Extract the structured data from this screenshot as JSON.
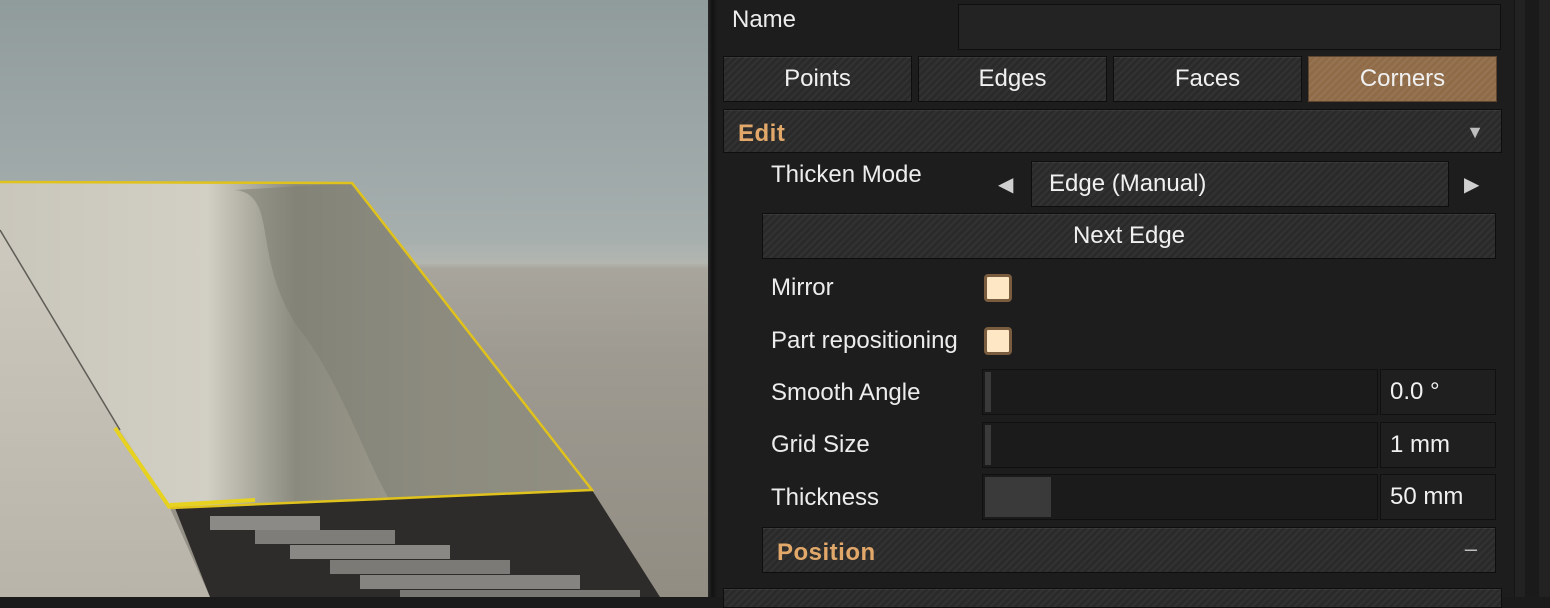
{
  "name_label": "Name",
  "name_value": "",
  "tabs": [
    {
      "label": "Points",
      "active": false
    },
    {
      "label": "Edges",
      "active": false
    },
    {
      "label": "Faces",
      "active": false
    },
    {
      "label": "Corners",
      "active": true
    }
  ],
  "edit_section": {
    "title": "Edit",
    "toggle_icon": "triangle-down-icon"
  },
  "thicken_mode": {
    "label": "Thicken Mode",
    "value": "Edge (Manual)",
    "prev_icon": "triangle-left-icon",
    "next_icon": "triangle-right-icon"
  },
  "next_edge_label": "Next Edge",
  "mirror": {
    "label": "Mirror",
    "checked": false
  },
  "part_repositioning": {
    "label": "Part repositioning",
    "checked": false
  },
  "smooth_angle": {
    "label": "Smooth Angle",
    "value": "0.0 °",
    "level": 0.0
  },
  "grid_size": {
    "label": "Grid Size",
    "value": "1 mm",
    "level": 0.0
  },
  "thickness": {
    "label": "Thickness",
    "value": "50 mm",
    "level": 0.17
  },
  "position_section": {
    "title": "Position",
    "toggle_icon": "minus-icon"
  },
  "colors": {
    "accent": "#e2a86a",
    "active_tab": "#8f6b48",
    "checkbox_fill": "#fde7c4",
    "selection_outline": "#e0c21c"
  }
}
